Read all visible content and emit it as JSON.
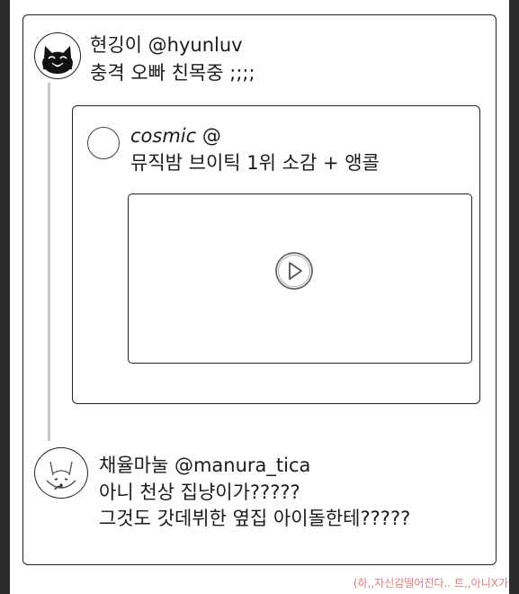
{
  "main_post": {
    "name": "현깅이",
    "handle": "@hyunluv",
    "text": "충격 오빠 친목중 ;;;;",
    "avatar_icon": "cat-face-icon"
  },
  "quoted_post": {
    "name": "cosmic",
    "handle": "@",
    "text": "뮤직밤 브이틱 1위 소감 + 앵콜",
    "avatar_icon": "blank-circle-avatar",
    "media_icon": "play-icon"
  },
  "reply_post": {
    "name": "채율마눌",
    "handle": "@manura_tica",
    "lines": [
      "아니 천상 집냥이가?????",
      "그것도 갓데뷔한 옆집 아이돌한테?????"
    ],
    "avatar_icon": "fox-face-icon"
  },
  "caption": "(하,,자신감떨어진다.. 트,,아니X가",
  "colors": {
    "border": "#222222",
    "thread_line": "#c6c6c6",
    "caption": "#e67a7a"
  }
}
